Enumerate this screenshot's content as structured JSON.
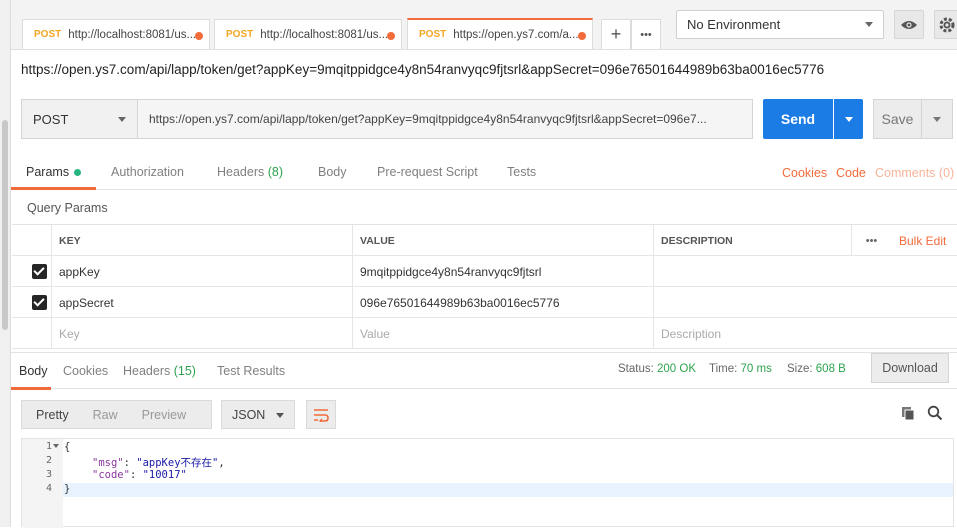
{
  "tabs": [
    {
      "method": "POST",
      "url": "http://localhost:8081/us...",
      "active": false
    },
    {
      "method": "POST",
      "url": "http://localhost:8081/us...",
      "active": false
    },
    {
      "method": "POST",
      "url": "https://open.ys7.com/a...",
      "active": true
    }
  ],
  "tabs_toolbar": {
    "add_label": "+",
    "more_label": "•••"
  },
  "environment": {
    "selected": "No Environment"
  },
  "request": {
    "title": "https://open.ys7.com/api/lapp/token/get?appKey=9mqitppidgce4y8n54ranvyqc9fjtsrl&appSecret=096e76501644989b63ba0016ec5776",
    "method": "POST",
    "url_display": "https://open.ys7.com/api/lapp/token/get?appKey=9mqitppidgce4y8n54ranvyqc9fjtsrl&appSecret=096e7...",
    "send_label": "Send",
    "save_label": "Save"
  },
  "request_tabs": {
    "params": "Params",
    "authorization": "Authorization",
    "headers": "Headers",
    "headers_count": "(8)",
    "body": "Body",
    "prerequest": "Pre-request Script",
    "tests": "Tests",
    "cookies": "Cookies",
    "code": "Code",
    "comments": "Comments (0)"
  },
  "query_params": {
    "title": "Query Params",
    "columns": {
      "key": "KEY",
      "value": "VALUE",
      "description": "DESCRIPTION"
    },
    "bulk_edit": "Bulk Edit",
    "more": "•••",
    "rows": [
      {
        "key": "appKey",
        "value": "9mqitppidgce4y8n54ranvyqc9fjtsrl",
        "description": "",
        "checked": true
      },
      {
        "key": "appSecret",
        "value": "096e76501644989b63ba0016ec5776",
        "description": "",
        "checked": true
      }
    ],
    "placeholder": {
      "key": "Key",
      "value": "Value",
      "description": "Description"
    }
  },
  "response_tabs": {
    "body": "Body",
    "cookies": "Cookies",
    "headers": "Headers",
    "headers_count": "(15)",
    "test_results": "Test Results"
  },
  "response_status": {
    "status_label": "Status:",
    "status_value": "200 OK",
    "time_label": "Time:",
    "time_value": "70 ms",
    "size_label": "Size:",
    "size_value": "608 B",
    "download_label": "Download"
  },
  "format_toolbar": {
    "pretty": "Pretty",
    "raw": "Raw",
    "preview": "Preview",
    "format": "JSON"
  },
  "response_body": {
    "line_numbers": [
      "1",
      "2",
      "3",
      "4"
    ],
    "open_brace": "{",
    "msg_key": "\"msg\"",
    "msg_value": "\"appKey不存在\"",
    "code_key": "\"code\"",
    "code_value": "\"10017\"",
    "close_brace": "}"
  },
  "colors": {
    "accent": "#f26b3a",
    "send": "#1a7ce4",
    "success": "#2ea44f",
    "method": "#f5a623"
  }
}
